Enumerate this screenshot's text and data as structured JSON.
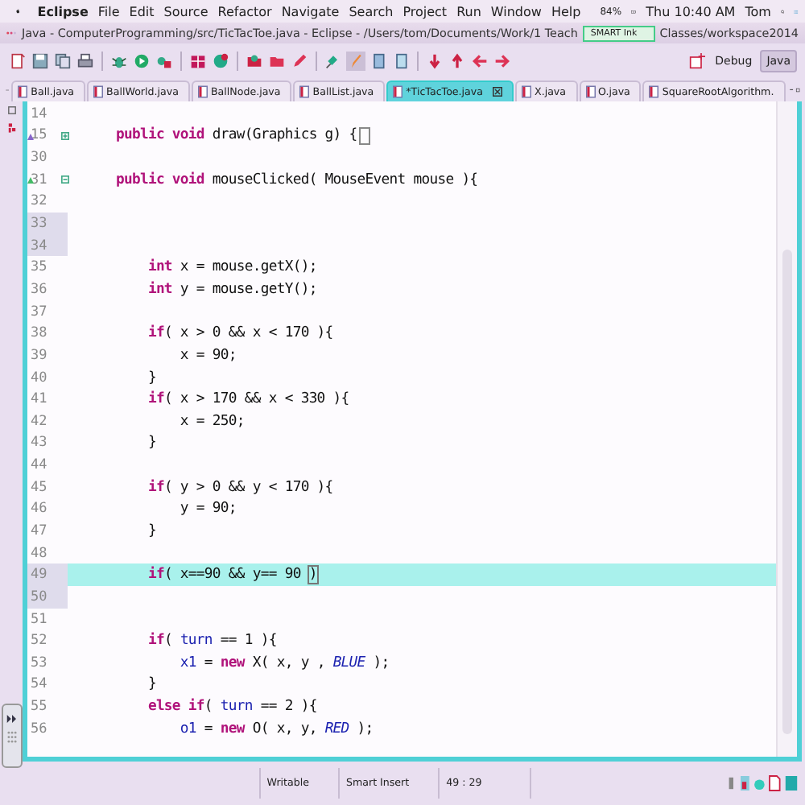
{
  "menu_bar": {
    "app": "Eclipse",
    "items": [
      "File",
      "Edit",
      "Source",
      "Refactor",
      "Navigate",
      "Search",
      "Project",
      "Run",
      "Window",
      "Help"
    ],
    "battery": "84%",
    "clock": "Thu 10:40 AM",
    "user": "Tom"
  },
  "window": {
    "title": "Java - ComputerProgramming/src/TicTacToe.java - Eclipse - /Users/tom/Documents/Work/1 Teach",
    "title_rest": "Classes/workspace2014"
  },
  "overlay": {
    "label": "SMART Ink"
  },
  "perspectives": [
    {
      "label": "Debug",
      "selected": false
    },
    {
      "label": "Java",
      "selected": true
    }
  ],
  "tabs": [
    {
      "label": "Ball.java",
      "selected": false
    },
    {
      "label": "BallWorld.java",
      "selected": false
    },
    {
      "label": "BallNode.java",
      "selected": false
    },
    {
      "label": "BallList.java",
      "selected": false
    },
    {
      "label": "*TicTacToe.java",
      "selected": true
    },
    {
      "label": "X.java",
      "selected": false
    },
    {
      "label": "O.java",
      "selected": false
    },
    {
      "label": "SquareRootAlgorithm.",
      "selected": false
    }
  ],
  "code": [
    {
      "number": "14",
      "current": false,
      "marked": false
    },
    {
      "number": "15",
      "current": false,
      "marked": false,
      "folded": true,
      "segments": [
        {
          "kind": "keyword",
          "text": "    public void"
        },
        {
          "kind": "plain",
          "text": " draw(Graphics g) {"
        }
      ]
    },
    {
      "number": "30",
      "current": false,
      "marked": false
    },
    {
      "number": "31",
      "current": false,
      "marked": false,
      "folded": false,
      "segments": [
        {
          "kind": "keyword",
          "text": "    public void"
        },
        {
          "kind": "plain",
          "text": " mouseClicked( MouseEvent mouse ){"
        }
      ]
    },
    {
      "number": "32",
      "current": false,
      "marked": false
    },
    {
      "number": "33",
      "current": false,
      "marked": true
    },
    {
      "number": "34",
      "current": false,
      "marked": true
    },
    {
      "number": "35",
      "current": false,
      "marked": false,
      "segments": [
        {
          "kind": "keyword",
          "text": "        int"
        },
        {
          "kind": "plain",
          "text": " x = mouse.getX();"
        }
      ]
    },
    {
      "number": "36",
      "current": false,
      "marked": false,
      "segments": [
        {
          "kind": "keyword",
          "text": "        int"
        },
        {
          "kind": "plain",
          "text": " y = mouse.getY();"
        }
      ]
    },
    {
      "number": "37",
      "current": false,
      "marked": false
    },
    {
      "number": "38",
      "current": false,
      "marked": false,
      "segments": [
        {
          "kind": "keyword",
          "text": "        if"
        },
        {
          "kind": "plain",
          "text": "( x > 0 && x < 170 ){"
        }
      ]
    },
    {
      "number": "39",
      "current": false,
      "marked": false,
      "segments": [
        {
          "kind": "plain",
          "text": "            x = 90;"
        }
      ]
    },
    {
      "number": "40",
      "current": false,
      "marked": false,
      "segments": [
        {
          "kind": "plain",
          "text": "        }"
        }
      ]
    },
    {
      "number": "41",
      "current": false,
      "marked": false,
      "segments": [
        {
          "kind": "keyword",
          "text": "        if"
        },
        {
          "kind": "plain",
          "text": "( x > 170 && x < 330 ){"
        }
      ]
    },
    {
      "number": "42",
      "current": false,
      "marked": false,
      "segments": [
        {
          "kind": "plain",
          "text": "            x = 250;"
        }
      ]
    },
    {
      "number": "43",
      "current": false,
      "marked": false,
      "segments": [
        {
          "kind": "plain",
          "text": "        }"
        }
      ]
    },
    {
      "number": "44",
      "current": false,
      "marked": false
    },
    {
      "number": "45",
      "current": false,
      "marked": false,
      "segments": [
        {
          "kind": "keyword",
          "text": "        if"
        },
        {
          "kind": "plain",
          "text": "( y > 0 && y < 170 ){"
        }
      ]
    },
    {
      "number": "46",
      "current": false,
      "marked": false,
      "segments": [
        {
          "kind": "plain",
          "text": "            y = 90;"
        }
      ]
    },
    {
      "number": "47",
      "current": false,
      "marked": false,
      "segments": [
        {
          "kind": "plain",
          "text": "        }"
        }
      ]
    },
    {
      "number": "48",
      "current": false,
      "marked": false
    },
    {
      "number": "49",
      "current": true,
      "marked": true,
      "segments": [
        {
          "kind": "keyword",
          "text": "        if"
        },
        {
          "kind": "plain",
          "text": "( x==90 && y== 90 "
        },
        {
          "kind": "bracket",
          "text": ")"
        }
      ]
    },
    {
      "number": "50",
      "current": false,
      "marked": true
    },
    {
      "number": "51",
      "current": false,
      "marked": false
    },
    {
      "number": "52",
      "current": false,
      "marked": false,
      "segments": [
        {
          "kind": "keyword",
          "text": "        if"
        },
        {
          "kind": "plain",
          "text": "( "
        },
        {
          "kind": "field",
          "text": "turn"
        },
        {
          "kind": "plain",
          "text": " == 1 ){"
        }
      ]
    },
    {
      "number": "53",
      "current": false,
      "marked": false,
      "segments": [
        {
          "kind": "field",
          "text": "            x1"
        },
        {
          "kind": "plain",
          "text": " = "
        },
        {
          "kind": "keyword",
          "text": "new"
        },
        {
          "kind": "plain",
          "text": " X( x, y , "
        },
        {
          "kind": "constant",
          "text": "BLUE"
        },
        {
          "kind": "plain",
          "text": " );"
        }
      ]
    },
    {
      "number": "54",
      "current": false,
      "marked": false,
      "segments": [
        {
          "kind": "plain",
          "text": "        }"
        }
      ]
    },
    {
      "number": "55",
      "current": false,
      "marked": false,
      "segments": [
        {
          "kind": "keyword",
          "text": "        else if"
        },
        {
          "kind": "plain",
          "text": "( "
        },
        {
          "kind": "field",
          "text": "turn"
        },
        {
          "kind": "plain",
          "text": " == 2 ){"
        }
      ]
    },
    {
      "number": "56",
      "current": false,
      "marked": false,
      "segments": [
        {
          "kind": "field",
          "text": "            o1"
        },
        {
          "kind": "plain",
          "text": " = "
        },
        {
          "kind": "keyword",
          "text": "new"
        },
        {
          "kind": "plain",
          "text": " O( x, y, "
        },
        {
          "kind": "constant",
          "text": "RED"
        },
        {
          "kind": "plain",
          "text": " );"
        }
      ]
    }
  ],
  "status_bar": {
    "mode": "Writable",
    "insert": "Smart Insert",
    "position": "49 : 29"
  }
}
